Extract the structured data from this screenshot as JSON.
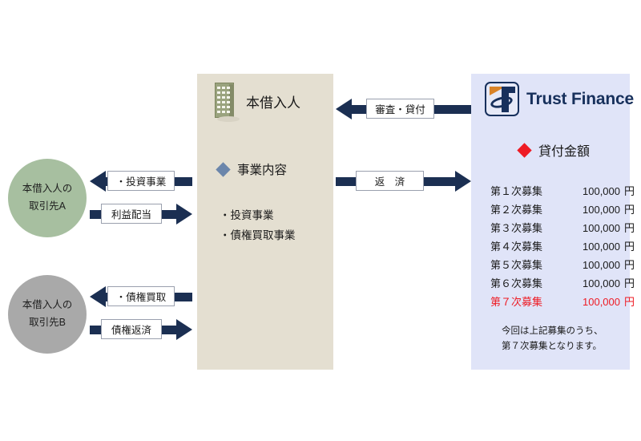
{
  "diagram": {
    "left_nodes": [
      {
        "name": "partner-a",
        "line1": "本借入人の",
        "line2": "取引先A",
        "color": "#a7bfa0"
      },
      {
        "name": "partner-b",
        "line1": "本借入人の",
        "line2": "取引先B",
        "color": "#a9a9a9"
      }
    ],
    "arrows": [
      {
        "name": "investment-business",
        "label": "・投資事業",
        "direction": "left"
      },
      {
        "name": "profit-distribution",
        "label": "利益配当",
        "direction": "right"
      },
      {
        "name": "claim-purchase",
        "label": "・債権買取",
        "direction": "left"
      },
      {
        "name": "claim-repayment",
        "label": "債権返済",
        "direction": "right"
      },
      {
        "name": "screening-lending",
        "label": "審査・貸付",
        "direction": "left"
      },
      {
        "name": "repayment",
        "label": "返　済",
        "direction": "right"
      }
    ],
    "center": {
      "borrower_label": "本借入人",
      "business_heading": "事業内容",
      "business_items": [
        "・投資事業",
        "・債権買取事業"
      ],
      "background": "#e4dfd1",
      "diamond_color": "#6b86ab"
    },
    "right": {
      "brand": "Trust Finance",
      "loan_heading": "貸付金額",
      "background": "#e0e4f8",
      "brand_color": "#17305c",
      "accent_color": "#d98327",
      "highlight_color": "#ee1b24",
      "loan_rows": [
        {
          "term": "第１次募集",
          "amount": "100,000",
          "unit": "円",
          "highlight": false
        },
        {
          "term": "第２次募集",
          "amount": "100,000",
          "unit": "円",
          "highlight": false
        },
        {
          "term": "第３次募集",
          "amount": "100,000",
          "unit": "円",
          "highlight": false
        },
        {
          "term": "第４次募集",
          "amount": "100,000",
          "unit": "円",
          "highlight": false
        },
        {
          "term": "第５次募集",
          "amount": "100,000",
          "unit": "円",
          "highlight": false
        },
        {
          "term": "第６次募集",
          "amount": "100,000",
          "unit": "円",
          "highlight": false
        },
        {
          "term": "第７次募集",
          "amount": "100,000",
          "unit": "円",
          "highlight": true
        }
      ],
      "note_line1": "今回は上記募集のうち、",
      "note_line2": "第７次募集となります。"
    }
  }
}
